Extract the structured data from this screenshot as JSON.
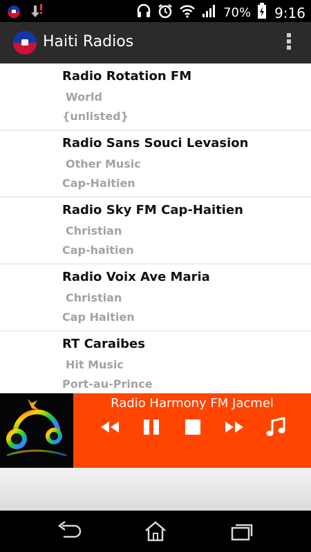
{
  "status_bar": {
    "battery": "70%",
    "time": "9:16",
    "icons": [
      "haiti-flag-icon",
      "download-icon",
      "headset-icon",
      "alarm-icon",
      "wifi-icon",
      "signal-icon",
      "battery-icon"
    ]
  },
  "app_bar": {
    "title": "Haiti Radios",
    "icon": "haiti-flag-icon",
    "menu_icon": "overflow-menu-icon"
  },
  "stations": [
    {
      "name": "Radio Rotation FM",
      "genre": "World",
      "city": "{unlisted}"
    },
    {
      "name": "Radio Sans Souci Levasion",
      "genre": "Other Music",
      "city": "Cap-Haitien"
    },
    {
      "name": "Radio Sky FM Cap-Haitien",
      "genre": "Christian",
      "city": "Cap-haitien"
    },
    {
      "name": "Radio Voix Ave Maria",
      "genre": "Christian",
      "city": "Cap Haitien"
    },
    {
      "name": "RT Caraibes",
      "genre": "Hit Music",
      "city": "Port-au-Prince"
    }
  ],
  "player": {
    "now_playing": "Radio Harmony FM Jacmel",
    "controls": [
      "previous-icon",
      "pause-icon",
      "stop-icon",
      "next-icon",
      "music-note-icon"
    ],
    "accent_color": "#ff4500"
  },
  "nav_bar": {
    "buttons": [
      "back-icon",
      "home-icon",
      "recent-apps-icon"
    ]
  }
}
